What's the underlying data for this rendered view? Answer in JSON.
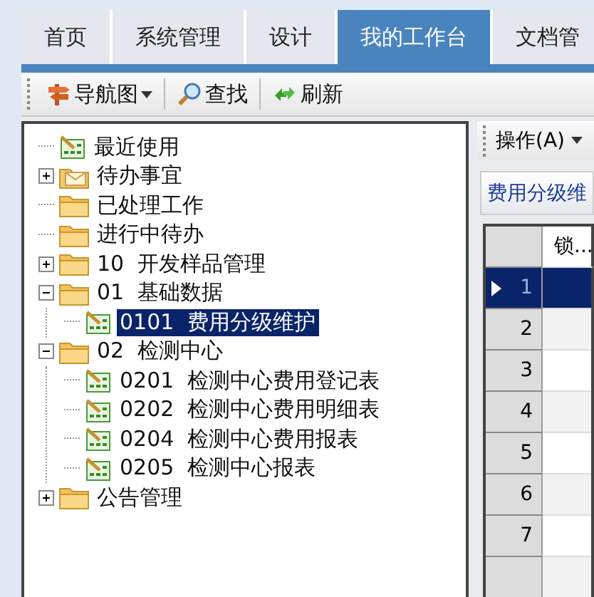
{
  "tabs": [
    {
      "label": "首页",
      "selected": false
    },
    {
      "label": "系统管理",
      "selected": false
    },
    {
      "label": "设计",
      "selected": false
    },
    {
      "label": "我的工作台",
      "selected": true
    },
    {
      "label": "文档管",
      "selected": false
    }
  ],
  "toolbar": [
    {
      "kind": "dropdown",
      "label": "导航图"
    },
    {
      "kind": "search",
      "label": "查找"
    },
    {
      "kind": "refresh",
      "label": "刷新"
    }
  ],
  "tree": [
    {
      "label": "最近使用",
      "kind": "sheet",
      "selected": false
    },
    {
      "label": "待办事宜",
      "kind": "envelope",
      "expanded": false,
      "selected": false
    },
    {
      "label": "已处理工作",
      "kind": "folder",
      "selected": false
    },
    {
      "label": "进行中待办",
      "kind": "folder",
      "selected": false
    },
    {
      "label": "10  开发样品管理",
      "kind": "folder",
      "expanded": false,
      "selected": false
    },
    {
      "label": "01  基础数据",
      "kind": "folder",
      "expanded": true,
      "selected": false,
      "children": [
        {
          "label": "0101  费用分级维护",
          "kind": "sheet",
          "selected": true
        }
      ]
    },
    {
      "label": "02  检测中心",
      "kind": "folder",
      "expanded": true,
      "selected": false,
      "children": [
        {
          "label": "0201  检测中心费用登记表",
          "kind": "sheet",
          "selected": false
        },
        {
          "label": "0202  检测中心费用明细表",
          "kind": "sheet",
          "selected": false
        },
        {
          "label": "0204  检测中心费用报表",
          "kind": "sheet",
          "selected": false
        },
        {
          "label": "0205  检测中心报表",
          "kind": "sheet",
          "selected": false
        }
      ]
    },
    {
      "label": "公告管理",
      "kind": "folder",
      "expanded": false,
      "selected": false
    }
  ],
  "right_panel": {
    "menu": "操作(A)",
    "title": "费用分级维",
    "grid": {
      "columns": [
        "锁..."
      ],
      "rows": [
        {
          "number": "1",
          "selected": true
        },
        {
          "number": "2",
          "selected": false
        },
        {
          "number": "3",
          "selected": false
        },
        {
          "number": "4",
          "selected": false
        },
        {
          "number": "5",
          "selected": false
        },
        {
          "number": "6",
          "selected": false
        },
        {
          "number": "7",
          "selected": false
        }
      ]
    }
  }
}
